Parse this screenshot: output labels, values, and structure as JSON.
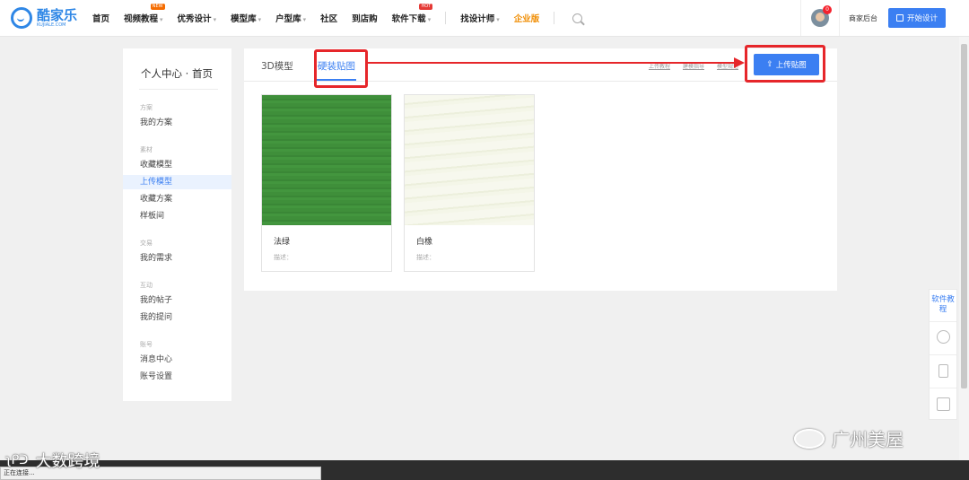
{
  "brand": {
    "name_cn": "酷家乐",
    "name_en": "KUJIALE.COM"
  },
  "nav": [
    {
      "label": "首页"
    },
    {
      "label": "视频教程",
      "caret": "▾",
      "badge": "NEW"
    },
    {
      "label": "优秀设计",
      "caret": "▾"
    },
    {
      "label": "模型库",
      "caret": "▾"
    },
    {
      "label": "户型库",
      "caret": "▾"
    },
    {
      "label": "社区"
    },
    {
      "label": "到店购"
    },
    {
      "label": "软件下载",
      "caret": "▾",
      "badge": "HOT"
    },
    {
      "label": "找设计师",
      "caret": "▾"
    },
    {
      "label": "企业版"
    }
  ],
  "header": {
    "notification_count": "0",
    "merchant_label": "商家后台",
    "start_design_label": "开始设计"
  },
  "sidebar": {
    "title": "个人中心 · 首页",
    "groups": [
      {
        "label": "方案",
        "items": [
          "我的方案"
        ]
      },
      {
        "label": "素材",
        "items": [
          "收藏模型",
          "上传模型",
          "收藏方案",
          "样板间"
        ]
      },
      {
        "label": "交易",
        "items": [
          "我的需求"
        ]
      },
      {
        "label": "互动",
        "items": [
          "我的帖子",
          "我的提问"
        ]
      },
      {
        "label": "账号",
        "items": [
          "消息中心",
          "账号设置"
        ]
      }
    ],
    "active_item": "上传模型"
  },
  "main": {
    "tabs": [
      {
        "label": "3D模型"
      },
      {
        "label": "硬装贴图"
      }
    ],
    "active_tab": "硬装贴图",
    "links": [
      "上传教程",
      "建模指导",
      "模型规范"
    ],
    "upload_button": "上传贴图",
    "cards": [
      {
        "name": "法绿",
        "desc": "描述："
      },
      {
        "name": "白橡",
        "desc": "描述："
      }
    ]
  },
  "float_bar": {
    "text": "软件教程"
  },
  "status_bar": "正在连接...",
  "watermarks": {
    "left": "大数跨境",
    "right": "广州美屋"
  },
  "colors": {
    "primary": "#3b7ff2",
    "annotation": "#e6262a",
    "enterprise": "#f08c00"
  }
}
